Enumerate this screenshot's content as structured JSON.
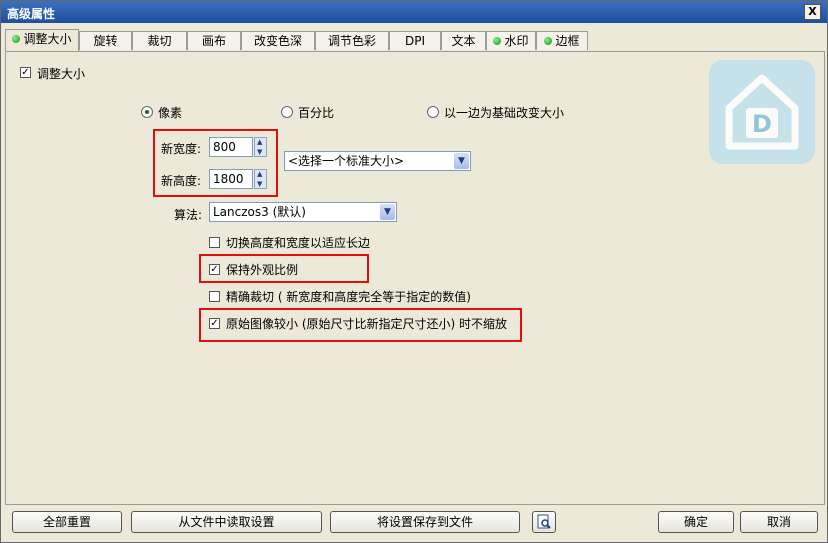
{
  "window": {
    "title": "高级属性",
    "close_label": "X"
  },
  "tabs": [
    {
      "label": "调整大小",
      "dot": true
    },
    {
      "label": "旋转",
      "dot": false
    },
    {
      "label": "裁切",
      "dot": false
    },
    {
      "label": "画布",
      "dot": false
    },
    {
      "label": "改变色深",
      "dot": false
    },
    {
      "label": "调节色彩",
      "dot": false
    },
    {
      "label": "DPI",
      "dot": false
    },
    {
      "label": "文本",
      "dot": false
    },
    {
      "label": "水印",
      "dot": true
    },
    {
      "label": "边框",
      "dot": true
    }
  ],
  "resize": {
    "enable_label": "调整大小",
    "enable_checked": true,
    "radio_pixels": "像素",
    "radio_percent": "百分比",
    "radio_side": "以一边为基础改变大小",
    "selected_mode": "像素",
    "width_label": "新宽度:",
    "width_value": "800",
    "height_label": "新高度:",
    "height_value": "1800",
    "standard_size": "<选择一个标准大小>",
    "algorithm_label": "算法:",
    "algorithm_value": "Lanczos3 (默认)",
    "opt_swap": "切换高度和宽度以适应长边",
    "opt_swap_checked": false,
    "opt_keep_ratio": "保持外观比例",
    "opt_keep_ratio_checked": true,
    "opt_exact_crop": "精确裁切 ( 新宽度和高度完全等于指定的数值)",
    "opt_exact_crop_checked": false,
    "opt_no_upscale": "原始图像较小 (原始尺寸比新指定尺寸还小) 时不缩放",
    "opt_no_upscale_checked": true
  },
  "footer": {
    "reset": "全部重置",
    "load": "从文件中读取设置",
    "save": "将设置保存到文件",
    "ok": "确定",
    "cancel": "取消"
  },
  "logo_letter": "D"
}
